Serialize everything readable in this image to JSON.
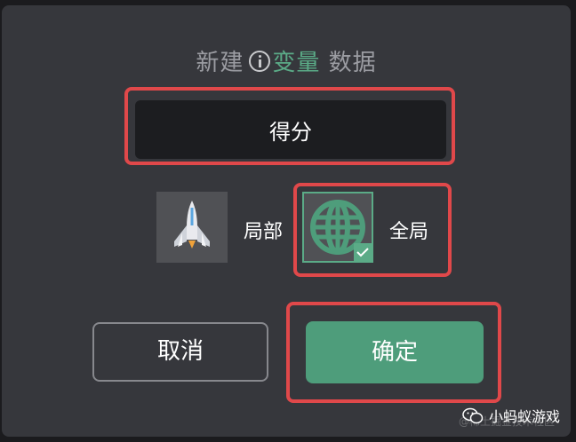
{
  "dialog": {
    "title_prefix": "新建",
    "title_accent": "变量",
    "title_suffix": "数据",
    "name_value": "得分",
    "scope_local_label": "局部",
    "scope_global_label": "全局",
    "scope_selected": "全局",
    "cancel_label": "取消",
    "confirm_label": "确定"
  },
  "watermark": {
    "text": "小蚂蚁游戏",
    "faint_text": "@稀土掘金技术社区"
  },
  "colors": {
    "accent": "#5bab87",
    "confirm": "#4e9d7b",
    "highlight": "#e0484a",
    "panel": "#36373c"
  },
  "icons": {
    "info": "info-circle-icon",
    "local": "rocket-ship-icon",
    "global": "globe-icon",
    "check": "checkmark-icon",
    "wechat": "wechat-icon"
  }
}
